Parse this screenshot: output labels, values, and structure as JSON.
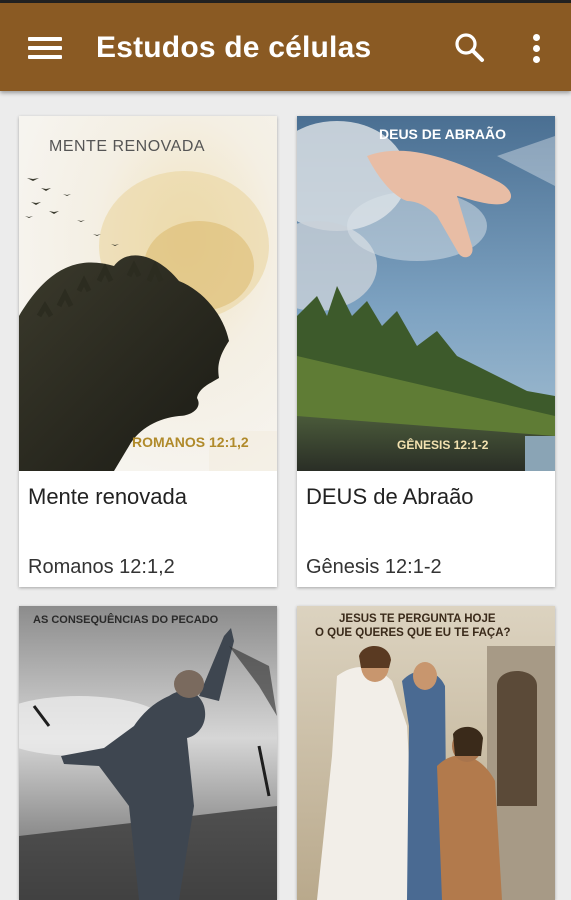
{
  "app_bar": {
    "title": "Estudos de células",
    "background": "#8a5a23",
    "icons": [
      "menu-icon",
      "search-icon",
      "more-vert-icon"
    ]
  },
  "cards": [
    {
      "title": "Mente renovada",
      "subtitle": "Romanos 12:1,2",
      "image_caption_top": "MENTE RENOVADA",
      "image_caption_bottom": "ROMANOS 12:1,2"
    },
    {
      "title": "DEUS de Abraão",
      "subtitle": "Gênesis 12:1-2",
      "image_caption_top": "DEUS DE ABRAÃO",
      "image_caption_bottom": "GÊNESIS 12:1-2"
    },
    {
      "image_caption_top": "AS CONSEQUÊNCIAS DO PECADO"
    },
    {
      "image_caption_top_line1": "JESUS TE PERGUNTA HOJE",
      "image_caption_top_line2": "O QUE QUERES QUE EU TE FAÇA?"
    }
  ]
}
